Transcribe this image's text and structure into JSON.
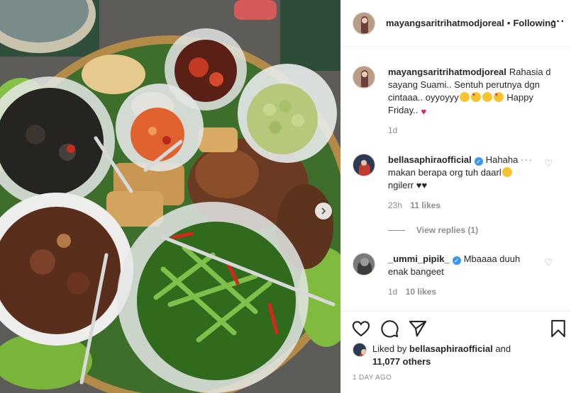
{
  "post": {
    "photo_alt": "food photo",
    "carousel_next_icon": "chevron-right-icon"
  },
  "header": {
    "username": "mayangsaritrihatmodjoreal",
    "separator": "•",
    "follow_label": "Following",
    "more_icon": "more-horizontal-icon"
  },
  "caption": {
    "username": "mayangsaritrihatmodjoreal",
    "text_1": "Rahasia d sayang Suami.. Sentuh perutnya dgn cintaaa.. oyyoyyy",
    "text_2": "Happy Friday..",
    "age": "1d"
  },
  "comments": [
    {
      "username": "bellasaphiraofficial",
      "verified": true,
      "text": "Hahaha makan berapa org tuh daarl",
      "text_2": "ngilerr ♥♥",
      "age": "23h",
      "likes": "11 likes"
    },
    {
      "username": "_ummi_pipik_",
      "verified": true,
      "text": "Mbaaaa duuh enak bangeet",
      "age": "1d",
      "likes": "10 likes"
    }
  ],
  "view_replies": "View replies (1)",
  "actions": {
    "like_icon": "heart-icon",
    "comment_icon": "comment-icon",
    "share_icon": "send-icon",
    "save_icon": "bookmark-icon"
  },
  "liked_by": {
    "prefix": "Liked by",
    "user": "bellasaphiraofficial",
    "and": "and",
    "others": "11,077 others"
  },
  "timestamp": "1 DAY AGO"
}
